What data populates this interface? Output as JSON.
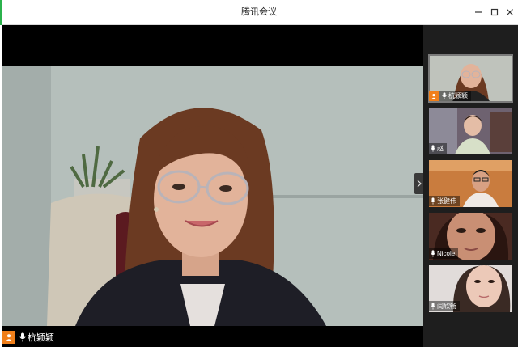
{
  "window": {
    "title": "腾讯会议",
    "minimize_icon": "minimize-icon",
    "maximize_icon": "maximize-icon",
    "close_icon": "close-icon"
  },
  "main_video": {
    "speaker_name": "杭颖颖",
    "icons": [
      "avatar-icon",
      "microphone-icon"
    ]
  },
  "participants": [
    {
      "name": "杭颖颖",
      "has_avatar_badge": true,
      "active": true
    },
    {
      "name": "赵",
      "has_avatar_badge": false,
      "active": false
    },
    {
      "name": "张健伟",
      "has_avatar_badge": false,
      "active": false
    },
    {
      "name": "Nicole",
      "has_avatar_badge": false,
      "active": false
    },
    {
      "name": "闫欣畅",
      "has_avatar_badge": false,
      "active": false
    }
  ],
  "colors": {
    "accent_orange": "#f07f1a",
    "window_green_edge": "#2bb24c",
    "sidebar_bg": "#1e1e1e"
  }
}
